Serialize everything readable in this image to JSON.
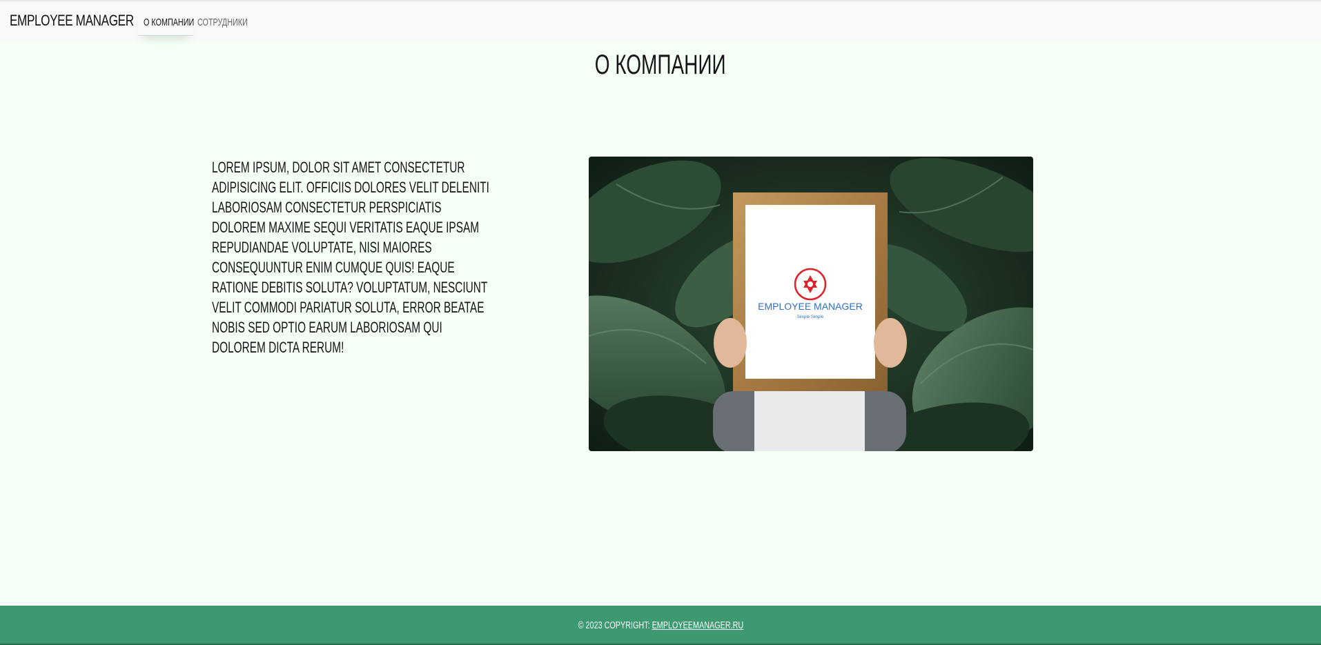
{
  "navbar": {
    "brand": "EMPLOYEE MANAGER",
    "links": [
      {
        "label": "О КОМПАНИИ",
        "active": true
      },
      {
        "label": "СОТРУДНИКИ",
        "active": false
      }
    ]
  },
  "main": {
    "title": "О КОМПАНИИ",
    "description": "LOREM IPSUM, DOLOR SIT AMET CONSECTETUR ADIPISICING ELIT. OFFICIIS DOLORES VELIT DELENITI LABORIOSAM CONSECTETUR PERSPICIATIS DOLOREM MAXIME SEQUI VERITATIS EAQUE IPSAM REPUDIANDAE VOLUPTATE, NISI MAIORES CONSEQUUNTUR ENIM CUMQUE QUIS! EAQUE RATIONE DEBITIS SOLUTA? VOLUPTATUM, NESCIUNT VELIT COMMODI PARIATUR SOLUTA, ERROR BEATAE NOBIS SED OPTIO EARUM LABORIOSAM QUI DOLOREM DICTA RERUM!",
    "image": {
      "logo_text": "EMPLOYEE MANAGER",
      "logo_tagline": "Simple Simple"
    }
  },
  "footer": {
    "copyright": "© 2023 COPYRIGHT: ",
    "link_text": "EMPLOYEEMANAGER.RU"
  },
  "colors": {
    "page_bg": "#f6fff6",
    "navbar_bg": "#f8f9fa",
    "footer_bg": "#3d9970",
    "logo_blue": "#2f6fcf",
    "logo_red": "#e0202a"
  }
}
